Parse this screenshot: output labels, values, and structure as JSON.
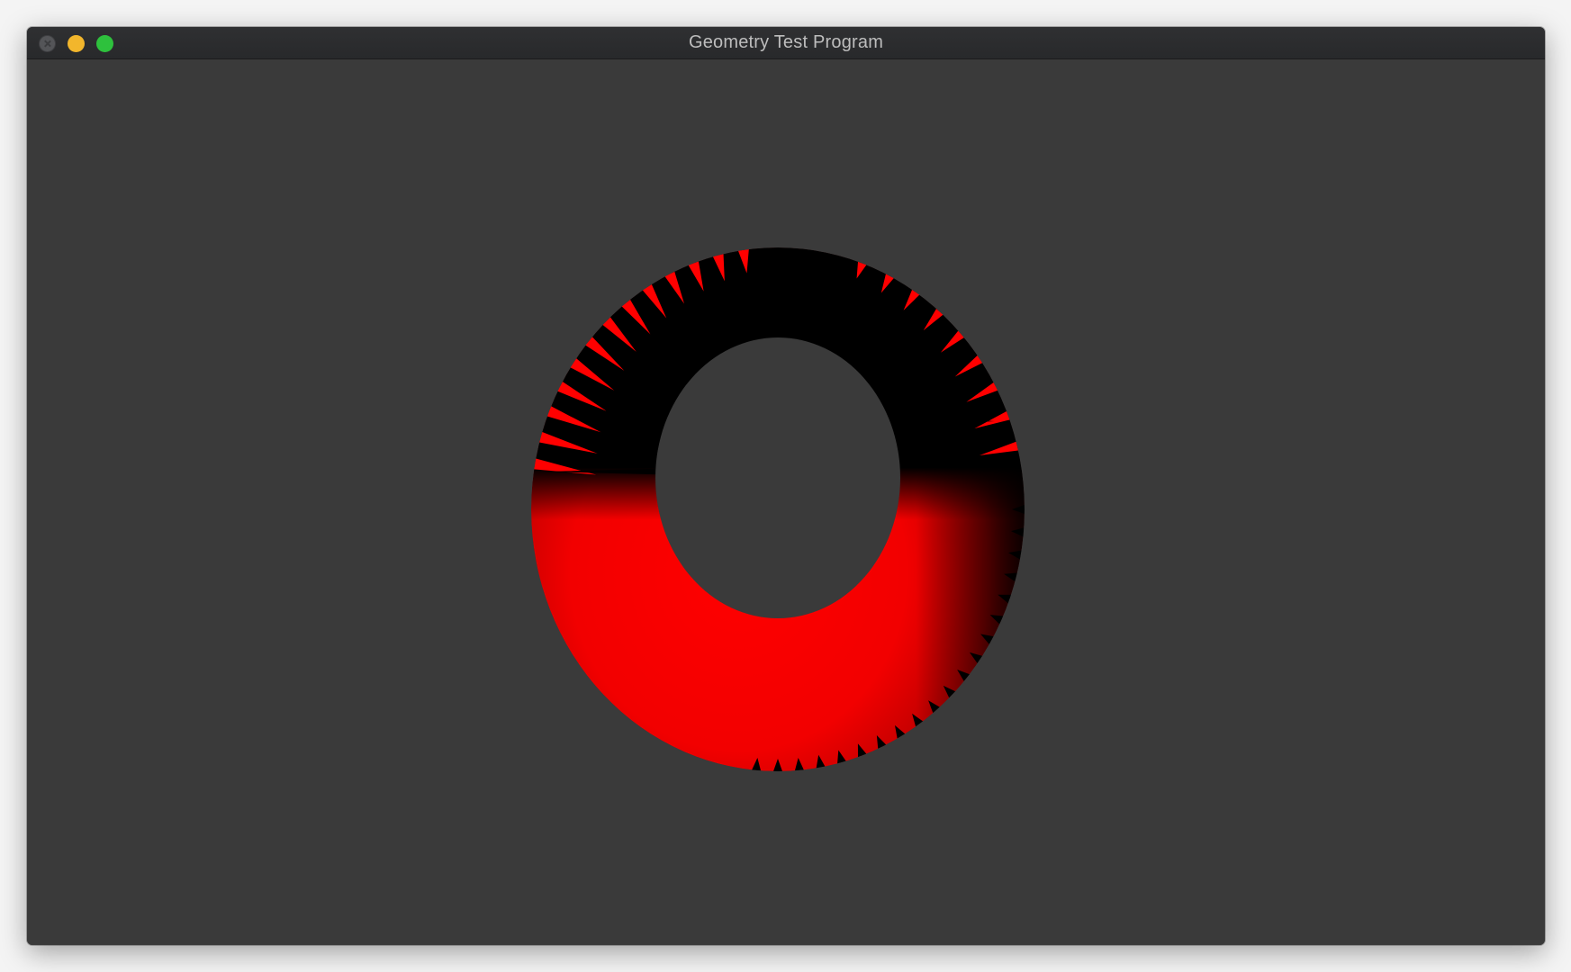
{
  "window": {
    "title": "Geometry Test Program",
    "controls": {
      "close_color": "#545558",
      "minimize_color": "#f2b62c",
      "zoom_color": "#2ec13d"
    }
  },
  "viewport": {
    "background_color": "#3a3a3a",
    "object": {
      "shape": "torus",
      "color": "#ff0000",
      "shadow_color": "#000000"
    }
  }
}
